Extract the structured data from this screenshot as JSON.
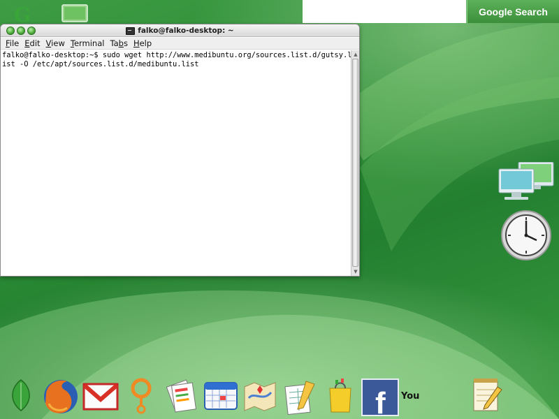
{
  "window": {
    "title": "falko@falko-desktop: ~"
  },
  "menu": [
    "File",
    "Edit",
    "View",
    "Terminal",
    "Tabs",
    "Help"
  ],
  "menu_mnemonics": [
    0,
    0,
    0,
    0,
    2,
    0
  ],
  "terminal": {
    "lines": [
      "falko@falko-desktop:~$ sudo wget http://www.medibuntu.org/sources.list.d/gutsy.l",
      "ist -O /etc/apt/sources.list.d/medibuntu.list"
    ]
  },
  "search": {
    "button_label": "Google Search",
    "input_value": ""
  },
  "dock": {
    "label_text": "You",
    "icons": [
      "leaf-icon",
      "firefox-icon",
      "gmail-icon",
      "orkut-icon",
      "news-icon",
      "calendar-icon",
      "maps-icon",
      "docs-icon",
      "shopping-bag-icon",
      "facebook-icon",
      "notepad-icon"
    ]
  },
  "colors": {
    "desktop_green": "#2f8f3a",
    "search_button": "#4fa34d",
    "facebook_blue": "#3b5998",
    "gmail_red": "#d93025"
  }
}
